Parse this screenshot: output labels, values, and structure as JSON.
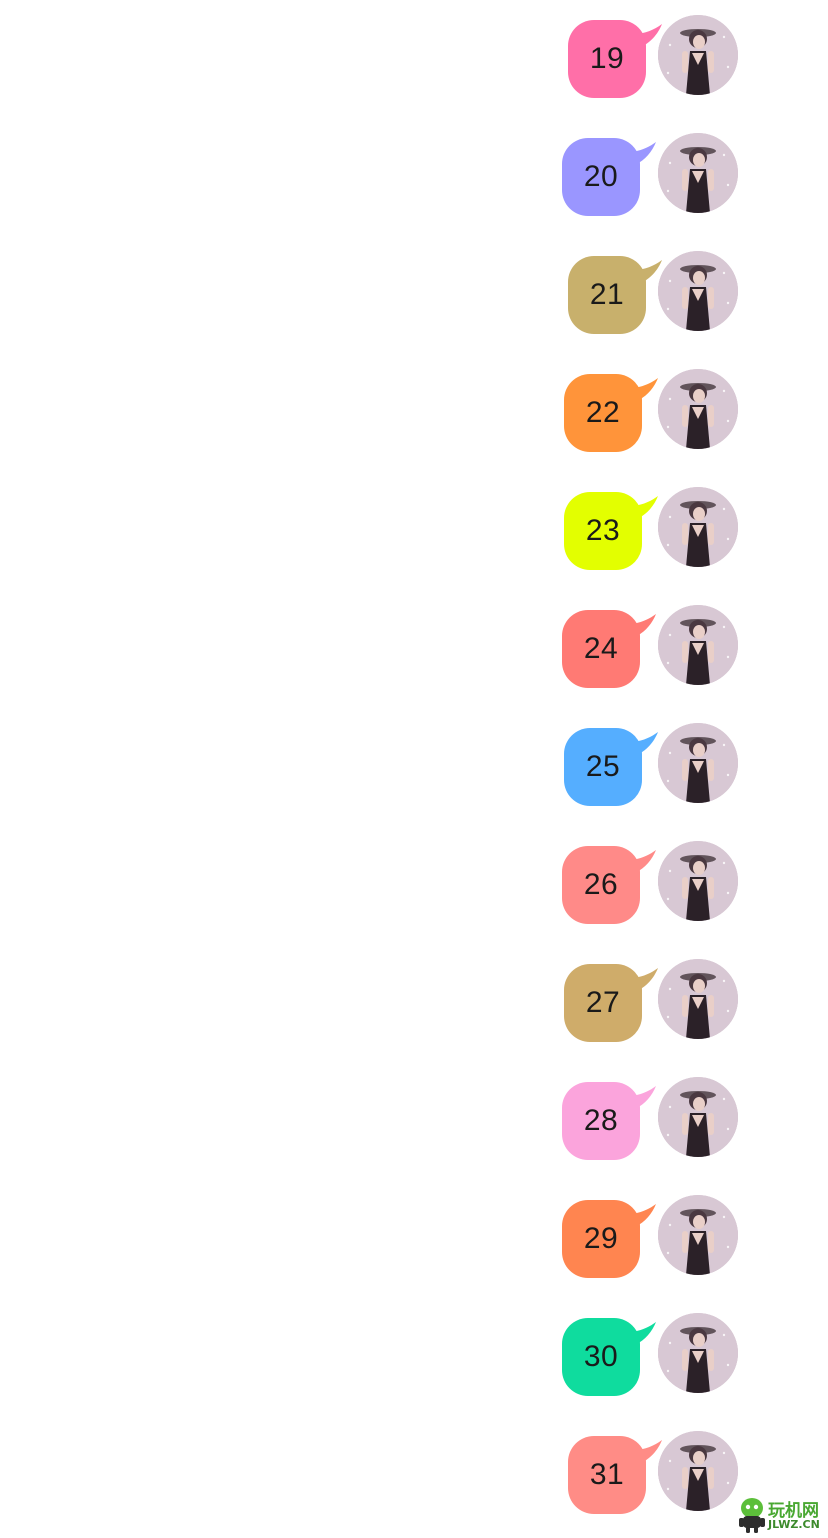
{
  "messages": [
    {
      "text": "19",
      "color": "#ff6fa8"
    },
    {
      "text": "20",
      "color": "#9a96ff"
    },
    {
      "text": "21",
      "color": "#c8b06c"
    },
    {
      "text": "22",
      "color": "#ff943a"
    },
    {
      "text": "23",
      "color": "#e3ff00"
    },
    {
      "text": "24",
      "color": "#ff7a74"
    },
    {
      "text": "25",
      "color": "#55aeff"
    },
    {
      "text": "26",
      "color": "#ff8a88"
    },
    {
      "text": "27",
      "color": "#cfac6a"
    },
    {
      "text": "28",
      "color": "#fba4dc"
    },
    {
      "text": "29",
      "color": "#ff8550"
    },
    {
      "text": "30",
      "color": "#0fdc9e"
    },
    {
      "text": "31",
      "color": "#ff8c86"
    }
  ],
  "avatar": {
    "icon": "user-avatar-photo"
  },
  "watermark": {
    "icon": "watermark-logo",
    "glyphs": "玩机网",
    "text": "JLWZ.CN"
  }
}
